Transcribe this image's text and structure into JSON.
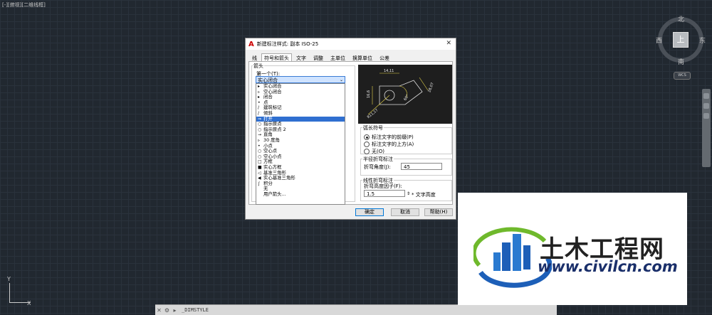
{
  "viewport_label": "[-][俯视][二维线框]",
  "viewcube": {
    "north": "北",
    "south": "南",
    "west": "西",
    "east": "东",
    "face": "上",
    "wcs": "WCS"
  },
  "ucs": {
    "x": "X",
    "y": "Y"
  },
  "command_line": {
    "text": "_DIMSTYLE"
  },
  "dialog": {
    "title": "新建标注样式: 副本 ISO-25",
    "tabs": [
      "线",
      "符号和箭头",
      "文字",
      "调整",
      "主单位",
      "换算单位",
      "公差"
    ],
    "arrows_group": "箭头",
    "first_label": "第一个(T):",
    "first_value": "实心闭合",
    "dropdown_items": [
      {
        "icon": "▸",
        "label": "实心闭合"
      },
      {
        "icon": "▹",
        "label": "空心闭合"
      },
      {
        "icon": "▸",
        "label": "闭合"
      },
      {
        "icon": "•",
        "label": "点"
      },
      {
        "icon": "/",
        "label": "建筑标记"
      },
      {
        "icon": "/",
        "label": "倾斜"
      },
      {
        "icon": "⇒",
        "label": "打开"
      },
      {
        "icon": "○",
        "label": "指示原点"
      },
      {
        "icon": "○",
        "label": "指示原点 2"
      },
      {
        "icon": "→",
        "label": "直角"
      },
      {
        "icon": "▹",
        "label": "30 度角"
      },
      {
        "icon": "•",
        "label": "小点"
      },
      {
        "icon": "○",
        "label": "空心点"
      },
      {
        "icon": "○",
        "label": "空心小点"
      },
      {
        "icon": "□",
        "label": "方框"
      },
      {
        "icon": "■",
        "label": "实心方框"
      },
      {
        "icon": "◁",
        "label": "基准三角形"
      },
      {
        "icon": "◀",
        "label": "实心基准三角形"
      },
      {
        "icon": "∫",
        "label": "积分"
      },
      {
        "icon": "",
        "label": "无"
      },
      {
        "icon": "",
        "label": "用户箭头..."
      }
    ],
    "selected_index": 6,
    "preview_dims": {
      "top": "14,11",
      "left": "16,6",
      "right": "28,07",
      "bottom": "R11,17",
      "angle": "60°"
    },
    "arc_symbol_group": "弧长符号",
    "arc_options": [
      "标注文字的前缀(P)",
      "标注文字的上方(A)",
      "无(O)"
    ],
    "arc_selected": 0,
    "radius_jog_group": "半径折弯标注",
    "jog_angle_label": "折弯角度(J):",
    "jog_angle_value": "45",
    "linear_jog_group": "线性折弯标注",
    "jog_height_label": "折弯高度因子(F):",
    "jog_height_value": "1.5",
    "jog_height_unit": "* 文字高度",
    "buttons": {
      "ok": "确定",
      "cancel": "取消",
      "help": "帮助(H)"
    }
  },
  "logo": {
    "name": "土木工程网",
    "url": "www.civilcn.com"
  }
}
